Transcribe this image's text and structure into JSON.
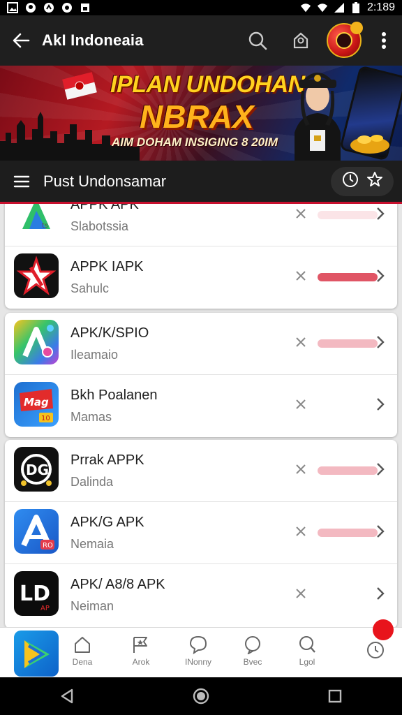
{
  "status_bar": {
    "time": "2:189"
  },
  "app_bar": {
    "title": "AkI Indoneaia"
  },
  "banner": {
    "headline": "IPLAN UNDOHAN",
    "headline2": "NBRAX",
    "tagline": "AIM DOHAM INSIGING 8 20IM"
  },
  "section": {
    "title": "Pust Undonsamar"
  },
  "colors": {
    "accent": "#c8102e",
    "bar_red": "#e05565",
    "bar_pink": "#f3b9c1",
    "bar_faint": "#fbe4e7"
  },
  "apps": [
    {
      "name": "APPK APK",
      "sub": "Slabotssia",
      "icon": "a-logo-icon",
      "bar": 0.9
    },
    {
      "name": "APPK IAPK",
      "sub": "Sahulc",
      "icon": "red-star-icon",
      "bar": 1.0
    },
    {
      "name": "APK/K/SPIO",
      "sub": "Ileamaio",
      "icon": "colorful-a-icon",
      "bar": 1.0
    },
    {
      "name": "Bkh Poalanen",
      "sub": "Mamas",
      "icon": "mag-icon",
      "bar": 0
    },
    {
      "name": "Prrak APPK",
      "sub": "Dalinda",
      "icon": "og-logo-icon",
      "bar": 1.0
    },
    {
      "name": "APK/G APK",
      "sub": "Nemaia",
      "icon": "blue-a-icon",
      "bar": 1.0
    },
    {
      "name": "APK/ A8/8 APK",
      "sub": "Neiman",
      "icon": "ld-logo-icon",
      "bar": 0
    }
  ],
  "bottom_nav": [
    {
      "label": "Dena",
      "icon": "home-icon"
    },
    {
      "label": "Arok",
      "icon": "star-flag-icon"
    },
    {
      "label": "INonny",
      "icon": "chat-icon"
    },
    {
      "label": "Bvec",
      "icon": "bubble-icon"
    },
    {
      "label": "Lgol",
      "icon": "search-chat-icon"
    }
  ]
}
